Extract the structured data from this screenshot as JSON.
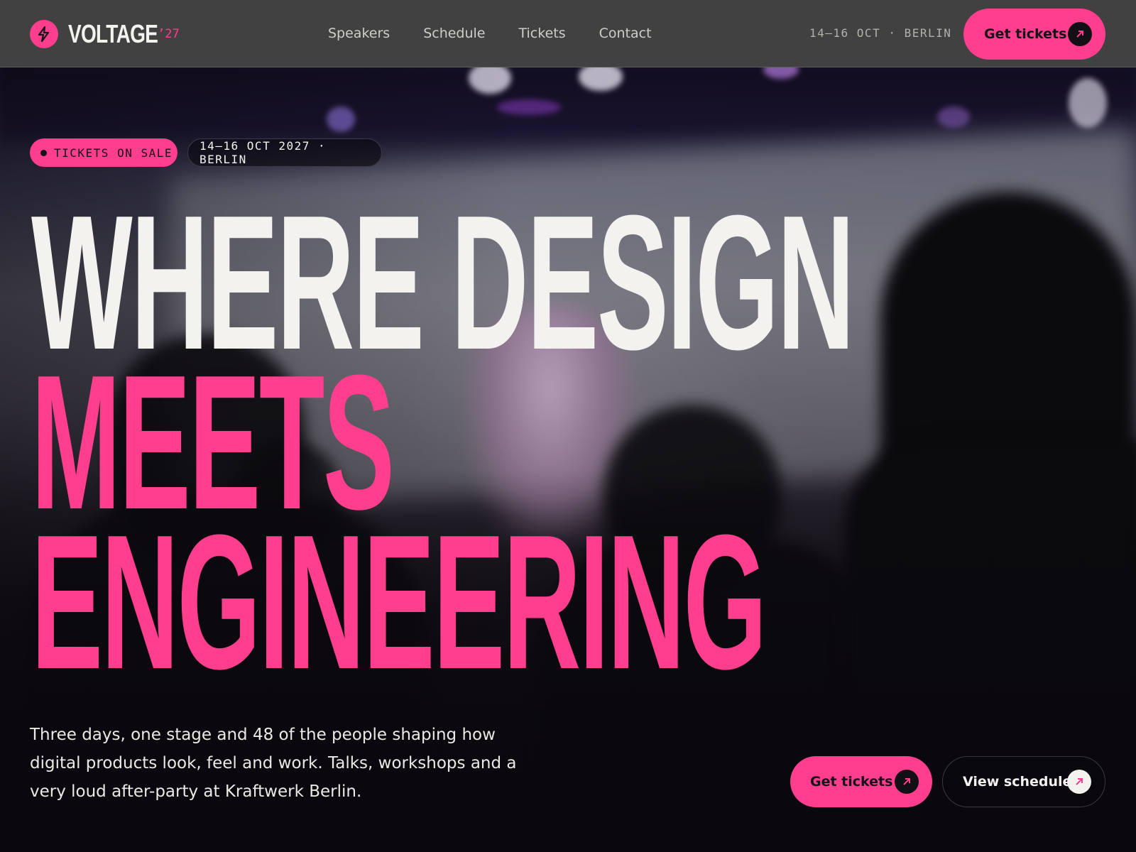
{
  "brand": {
    "name": "VOLTAGE",
    "year": "’27",
    "accent": "#ff3e8e",
    "icon": "lightning-bolt-icon"
  },
  "nav": {
    "items": [
      {
        "label": "Speakers"
      },
      {
        "label": "Schedule"
      },
      {
        "label": "Tickets"
      },
      {
        "label": "Contact"
      }
    ]
  },
  "header": {
    "date_location": "14–16 OCT · BERLIN",
    "cta_label": "Get tickets",
    "cta_icon": "arrow-up-right-icon"
  },
  "hero": {
    "badge_status": "TICKETS ON SALE",
    "badge_date": "14–16 OCT 2027 · BERLIN",
    "headline_line1": "WHERE DESIGN",
    "headline_line2": "MEETS",
    "headline_line3": "ENGINEERING",
    "lede": "Three days, one stage and 48 of the people shaping how digital products look, feel and work. Talks, workshops and a very loud after-party at Kraftwerk Berlin.",
    "primary_cta": "Get tickets",
    "secondary_cta": "View schedule"
  }
}
